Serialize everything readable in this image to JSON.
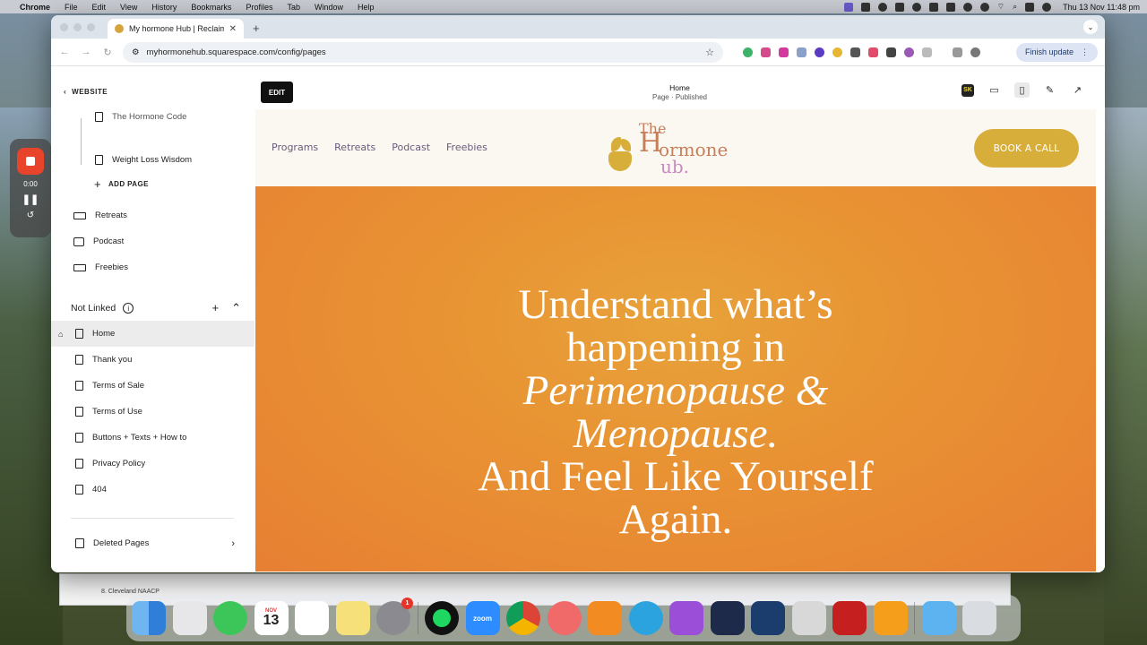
{
  "menubar": {
    "app": "Chrome",
    "menus": [
      "File",
      "Edit",
      "View",
      "History",
      "Bookmarks",
      "Profiles",
      "Tab",
      "Window",
      "Help"
    ],
    "clock": "Thu 13 Nov  11:48 pm"
  },
  "browser": {
    "tab_title": "My hormone Hub | Reclaim Yo",
    "url": "myhormonehub.squarespace.com/config/pages",
    "finish_update": "Finish update"
  },
  "recorder": {
    "time": "0:00"
  },
  "sidebar": {
    "back_label": "WEBSITE",
    "cut_item": "The Hormone Code",
    "child_item": "Weight Loss Wisdom",
    "add_page": "ADD PAGE",
    "linked_items": [
      {
        "label": "Retreats",
        "icon": "folder-icon"
      },
      {
        "label": "Podcast",
        "icon": "blog-icon"
      },
      {
        "label": "Freebies",
        "icon": "folder-icon"
      }
    ],
    "not_linked_title": "Not Linked",
    "not_linked_items": [
      "Home",
      "Thank you",
      "Terms of Sale",
      "Terms of Use",
      "Buttons + Texts + How to",
      "Privacy Policy",
      "404"
    ],
    "deleted": "Deleted Pages"
  },
  "editor": {
    "edit_label": "EDIT",
    "page_name": "Home",
    "page_status": "Page · Published",
    "tools": [
      "sk-extension-icon",
      "desktop-view-icon",
      "mobile-view-icon",
      "design-brush-icon",
      "open-external-icon"
    ]
  },
  "site": {
    "nav": [
      "Programs",
      "Retreats",
      "Podcast",
      "Freebies"
    ],
    "logo": {
      "the": "The",
      "h": "H",
      "ormone": "ormone",
      "ub": "ub."
    },
    "book_call": "BOOK A CALL",
    "hero": {
      "line1": "Understand what’s",
      "line2": "happening in",
      "line3": "Perimenopause &",
      "line4": "Menopause.",
      "line5": "And Feel Like Yourself",
      "line6": "Again."
    }
  },
  "background_sheet": {
    "row": "8. Cleveland NAACP"
  },
  "dock": {
    "calendar": {
      "month": "NOV",
      "day": "13"
    },
    "settings_badge": "1",
    "apps": [
      "finder-icon",
      "launchpad-icon",
      "messages-icon",
      "calendar-icon",
      "reminders-icon",
      "notes-icon",
      "system-settings-icon",
      "spotify-icon",
      "zoom-icon",
      "chrome-icon",
      "asana-icon",
      "books-icon",
      "telegram-icon",
      "podcasts-icon",
      "paper-plane-icon",
      "affinity-designer-icon",
      "color-ui-icon",
      "acrobat-icon",
      "pages-icon",
      "downloads-folder-icon",
      "trash-icon"
    ],
    "zoom_label": "zoom"
  },
  "colors": {
    "accent_gold": "#d8ae3b",
    "hero_orange": "#e8932f",
    "logo_terracotta": "#c77f5b",
    "logo_lilac": "#c88ac0"
  }
}
